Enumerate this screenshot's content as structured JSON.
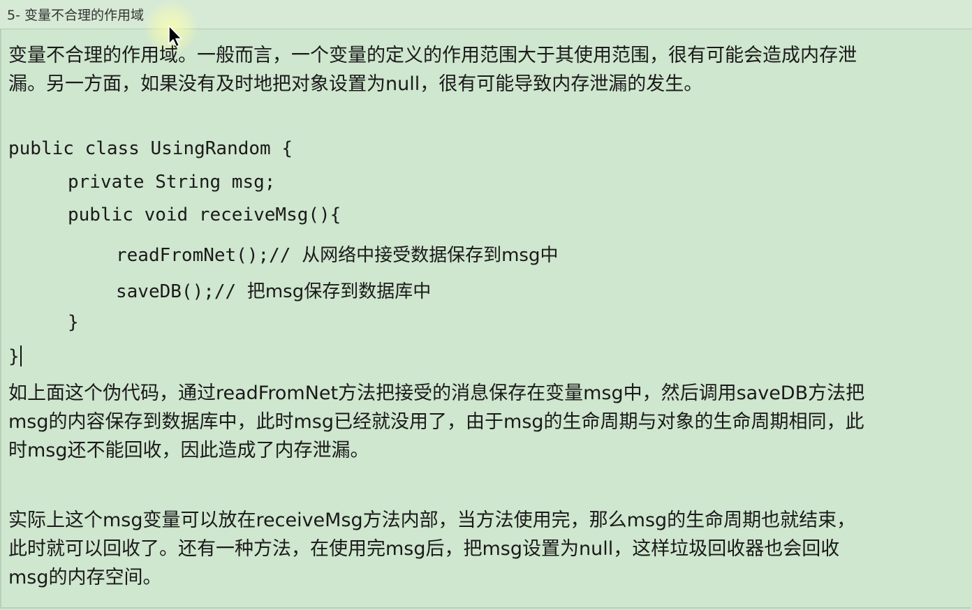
{
  "title": "5- 变量不合理的作用域",
  "intro": {
    "line1": "变量不合理的作用域。一般而言，一个变量的定义的作用范围大于其使用范围，很有可能会造成内存泄",
    "line2": "漏。另一方面，如果没有及时地把对象设置为null，很有可能导致内存泄漏的发生。"
  },
  "code": {
    "line1": "public class UsingRandom {",
    "line2": "private String msg;",
    "line3": "public void receiveMsg(){",
    "line4_code": "readFromNet();//",
    "line4_comment": "从网络中接受数据保存到msg中",
    "line5_code": "saveDB();//",
    "line5_comment": "把msg保存到数据库中",
    "line6": "}",
    "line7": "}"
  },
  "explain": {
    "line1": "如上面这个伪代码，通过readFromNet方法把接受的消息保存在变量msg中，然后调用saveDB方法把",
    "line2": "msg的内容保存到数据库中，此时msg已经就没用了，由于msg的生命周期与对象的生命周期相同，此",
    "line3": "时msg还不能回收，因此造成了内存泄漏。"
  },
  "solution": {
    "line1": "实际上这个msg变量可以放在receiveMsg方法内部，当方法使用完，那么msg的生命周期也就结束，",
    "line2": "此时就可以回收了。还有一种方法，在使用完msg后，把msg设置为null，这样垃圾回收器也会回收",
    "line3": "msg的内存空间。"
  },
  "colors": {
    "background": "#cfe6cf",
    "title_bar": "#d6ead6",
    "text": "#1a1a1a"
  }
}
